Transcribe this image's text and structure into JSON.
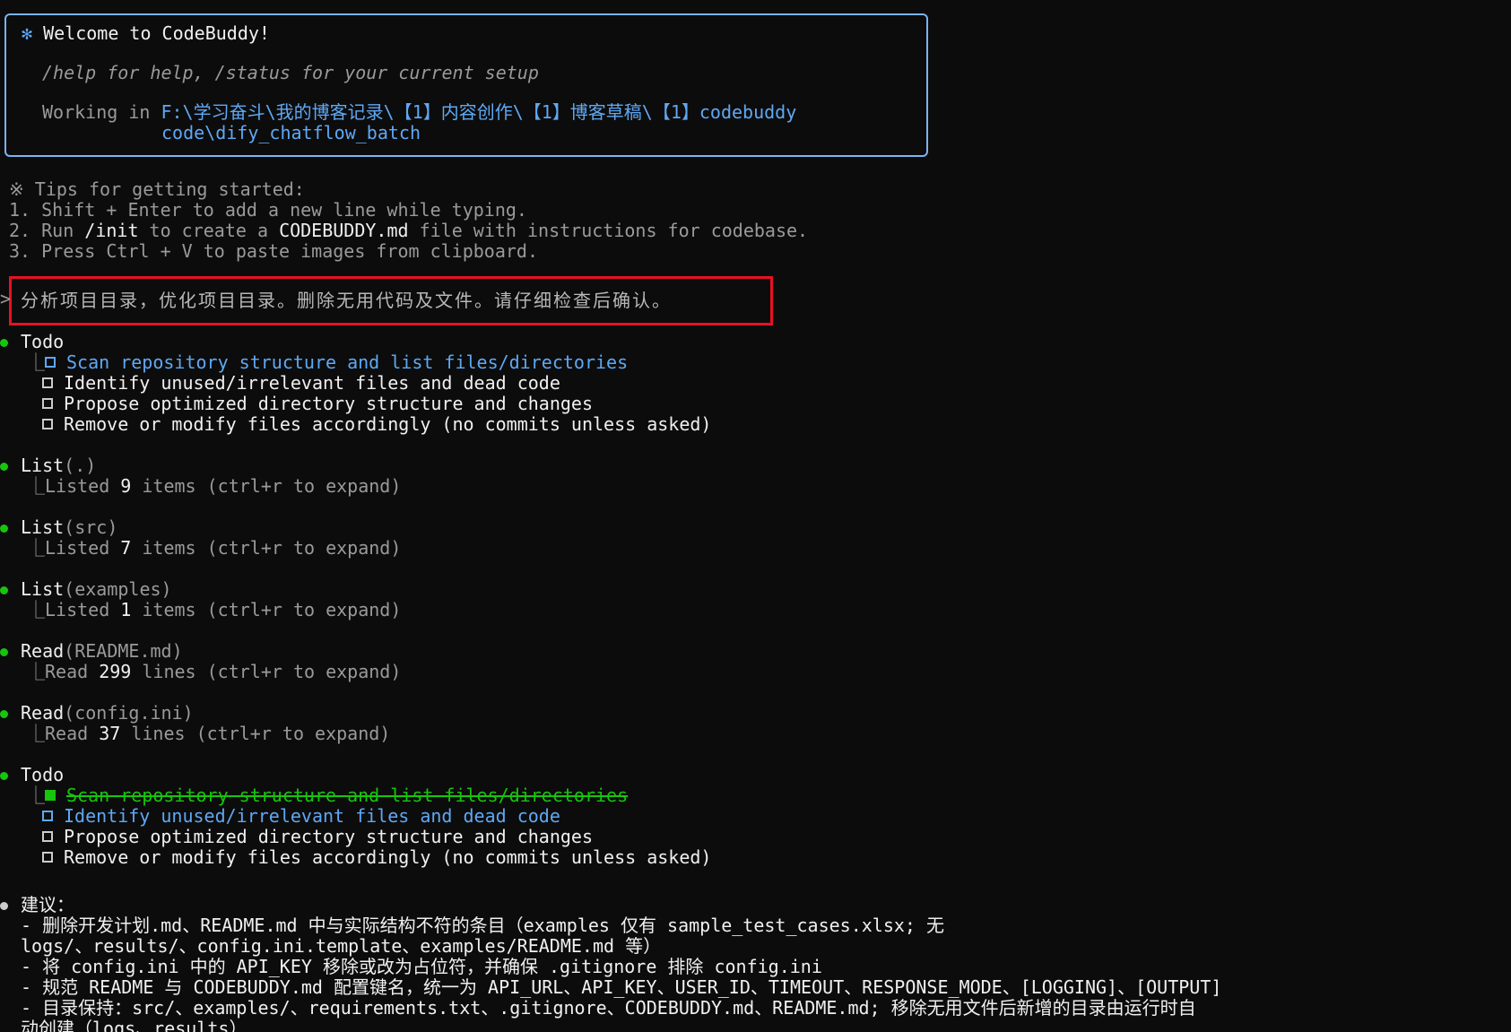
{
  "welcome": {
    "star": "✻",
    "title": "Welcome to CodeBuddy!",
    "help": "/help for help, /status for your current setup",
    "working_label": "Working in ",
    "path_line1": "F:\\学习奋斗\\我的博客记录\\【1】内容创作\\【1】博客草稿\\【1】codebuddy",
    "path_line2": "code\\dify_chatflow_batch"
  },
  "tips": {
    "header": "※ Tips for getting started:",
    "tip1": "1. Shift + Enter to add a new line while typing.",
    "tip2_prefix": "2. Run ",
    "tip2_cmd": "/init",
    "tip2_mid": " to create a ",
    "tip2_file": "CODEBUDDY.md",
    "tip2_suffix": " file with instructions for codebase.",
    "tip3": "3. Press Ctrl + V to paste images from clipboard."
  },
  "prompt": {
    "caret": ">",
    "text": "分析项目目录，优化项目目录。删除无用代码及文件。请仔细检查后确认。"
  },
  "todo1": {
    "title": "Todo",
    "items": [
      "Scan repository structure and list files/directories",
      "Identify unused/irrelevant files and dead code",
      "Propose optimized directory structure and changes",
      "Remove or modify files accordingly (no commits unless asked)"
    ]
  },
  "tools": [
    {
      "name": "List",
      "arg": "(.)",
      "result_prefix": "Listed ",
      "count": "9",
      "result_suffix": " items (ctrl+r to expand)"
    },
    {
      "name": "List",
      "arg": "(src)",
      "result_prefix": "Listed ",
      "count": "7",
      "result_suffix": " items (ctrl+r to expand)"
    },
    {
      "name": "List",
      "arg": "(examples)",
      "result_prefix": "Listed ",
      "count": "1",
      "result_suffix": " items (ctrl+r to expand)"
    },
    {
      "name": "Read",
      "arg": "(README.md)",
      "result_prefix": "Read ",
      "count": "299",
      "result_suffix": " lines (ctrl+r to expand)"
    },
    {
      "name": "Read",
      "arg": "(config.ini)",
      "result_prefix": "Read ",
      "count": "37",
      "result_suffix": " lines (ctrl+r to expand)"
    }
  ],
  "todo2": {
    "title": "Todo",
    "items": [
      "Scan repository structure and list files/directories",
      "Identify unused/irrelevant files and dead code",
      "Propose optimized directory structure and changes",
      "Remove or modify files accordingly (no commits unless asked)"
    ]
  },
  "suggestions": {
    "title": "建议：",
    "lines": [
      "- 删除开发计划.md、README.md 中与实际结构不符的条目（examples 仅有 sample_test_cases.xlsx; 无",
      "logs/、results/、config.ini.template、examples/README.md 等）",
      "- 将 config.ini 中的 API_KEY 移除或改为占位符，并确保 .gitignore 排除 config.ini",
      "- 规范 README 与 CODEBUDDY.md 配置键名，统一为 API_URL、API_KEY、USER_ID、TIMEOUT、RESPONSE_MODE、[LOGGING]、[OUTPUT]",
      "- 目录保持：src/、examples/、requirements.txt、.gitignore、CODEBUDDY.md、README.md; 移除无用文件后新增的目录由运行时自",
      "动创建（logs、results）"
    ]
  },
  "tree_glyph": "⎿",
  "colors": {
    "background": "#0c0c0c",
    "text": "#cccccc",
    "accent_blue": "#5fa8f4",
    "accent_green": "#16c60c",
    "highlight_red": "#e81123"
  }
}
